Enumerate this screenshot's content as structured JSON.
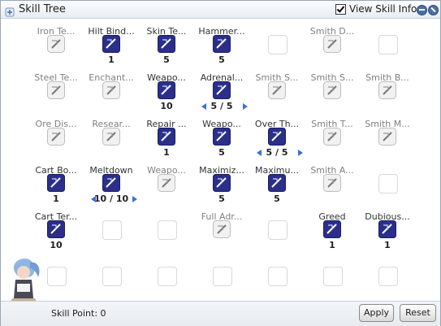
{
  "window": {
    "title": "Skill Tree",
    "view_info_label": "View Skill Info",
    "view_info_checked": true
  },
  "skills": [
    {
      "name": "Iron Te...",
      "level": "",
      "active": false,
      "icon": "anvil-icon",
      "arrows": false
    },
    {
      "name": "Hilt Bind...",
      "level": "1",
      "active": true,
      "icon": "hilt-binding-icon",
      "arrows": false
    },
    {
      "name": "Skin Te...",
      "level": "5",
      "active": true,
      "icon": "skin-tempering-icon",
      "arrows": false
    },
    {
      "name": "Hammer...",
      "level": "5",
      "active": true,
      "icon": "hammerfall-icon",
      "arrows": false
    },
    {
      "name": "",
      "level": "",
      "active": false,
      "icon": "",
      "arrows": false
    },
    {
      "name": "Smith D...",
      "level": "",
      "active": false,
      "icon": "smith-dagger-icon",
      "arrows": false
    },
    {
      "name": "",
      "level": "",
      "active": false,
      "icon": "",
      "arrows": false
    },
    {
      "name": "Steel Te...",
      "level": "",
      "active": false,
      "icon": "anvil-icon",
      "arrows": false
    },
    {
      "name": "Enchant...",
      "level": "",
      "active": false,
      "icon": "anvil-icon",
      "arrows": false
    },
    {
      "name": "Weapo...",
      "level": "10",
      "active": true,
      "icon": "weapon-perfection-icon",
      "arrows": false
    },
    {
      "name": "Adrenal...",
      "level": "5 / 5",
      "active": true,
      "icon": "adrenaline-rush-icon",
      "arrows": true
    },
    {
      "name": "Smith S...",
      "level": "",
      "active": false,
      "icon": "smith-sword-icon",
      "arrows": false
    },
    {
      "name": "Smith S...",
      "level": "",
      "active": false,
      "icon": "smith-sword-icon",
      "arrows": false
    },
    {
      "name": "Smith B...",
      "level": "",
      "active": false,
      "icon": "smith-brush-icon",
      "arrows": false
    },
    {
      "name": "Ore Dis...",
      "level": "",
      "active": false,
      "icon": "ore-discovery-icon",
      "arrows": false
    },
    {
      "name": "Resear...",
      "level": "",
      "active": false,
      "icon": "research-icon",
      "arrows": false
    },
    {
      "name": "Repair ...",
      "level": "1",
      "active": true,
      "icon": "repair-weapon-icon",
      "arrows": false
    },
    {
      "name": "Weapo...",
      "level": "5",
      "active": true,
      "icon": "weapon-research-icon",
      "arrows": false
    },
    {
      "name": "Over Th...",
      "level": "5 / 5",
      "active": true,
      "icon": "over-thrust-icon",
      "arrows": true
    },
    {
      "name": "Smith T...",
      "level": "",
      "active": false,
      "icon": "smith-twohand-icon",
      "arrows": false
    },
    {
      "name": "Smith M...",
      "level": "",
      "active": false,
      "icon": "smith-mace-icon",
      "arrows": false
    },
    {
      "name": "Cart Bo...",
      "level": "1",
      "active": true,
      "icon": "cart-boost-icon",
      "arrows": false
    },
    {
      "name": "Meltdown",
      "level": "10 / 10",
      "active": true,
      "icon": "meltdown-icon",
      "arrows": true
    },
    {
      "name": "Weapo...",
      "level": "",
      "active": false,
      "icon": "weaponry-icon",
      "arrows": false
    },
    {
      "name": "Maximiz...",
      "level": "5",
      "active": true,
      "icon": "maximize-power-icon",
      "arrows": false
    },
    {
      "name": "Maximu...",
      "level": "5",
      "active": true,
      "icon": "maximum-over-thrust-icon",
      "arrows": false
    },
    {
      "name": "Smith A...",
      "level": "",
      "active": false,
      "icon": "smith-axe-icon",
      "arrows": false
    },
    {
      "name": "",
      "level": "",
      "active": false,
      "icon": "",
      "arrows": false
    },
    {
      "name": "Cart Ter...",
      "level": "10",
      "active": true,
      "icon": "cart-termination-icon",
      "arrows": false
    },
    {
      "name": "",
      "level": "",
      "active": false,
      "icon": "",
      "arrows": false
    },
    {
      "name": "",
      "level": "",
      "active": false,
      "icon": "",
      "arrows": false
    },
    {
      "name": "Full Adr...",
      "level": "",
      "active": false,
      "icon": "full-adrenaline-icon",
      "arrows": false
    },
    {
      "name": "",
      "level": "",
      "active": false,
      "icon": "",
      "arrows": false
    },
    {
      "name": "Greed",
      "level": "1",
      "active": true,
      "icon": "greed-icon",
      "arrows": false
    },
    {
      "name": "Dubious...",
      "level": "1",
      "active": true,
      "icon": "dubious-icon",
      "arrows": false
    },
    {
      "name": "",
      "level": "",
      "active": false,
      "icon": "",
      "arrows": false
    },
    {
      "name": "",
      "level": "",
      "active": false,
      "icon": "",
      "arrows": false
    },
    {
      "name": "",
      "level": "",
      "active": false,
      "icon": "",
      "arrows": false
    },
    {
      "name": "",
      "level": "",
      "active": false,
      "icon": "",
      "arrows": false
    },
    {
      "name": "",
      "level": "",
      "active": false,
      "icon": "",
      "arrows": false
    },
    {
      "name": "",
      "level": "",
      "active": false,
      "icon": "",
      "arrows": false
    },
    {
      "name": "",
      "level": "",
      "active": false,
      "icon": "",
      "arrows": false
    }
  ],
  "footer": {
    "skill_point": "Skill Point: 0",
    "apply_label": "Apply",
    "reset_label": "Reset"
  },
  "colors": {
    "accent": "#3f6fd8",
    "active_icon": "#2b2f8a",
    "inactive_icon": "#9a9a9a"
  }
}
